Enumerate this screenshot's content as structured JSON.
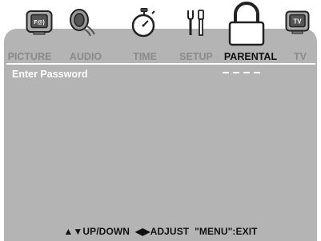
{
  "tabs": [
    {
      "label": "PICTURE",
      "icon": "picture-icon",
      "active": false
    },
    {
      "label": "AUDIO",
      "icon": "speaker-icon",
      "active": false
    },
    {
      "label": "TIME",
      "icon": "stopwatch-icon",
      "active": false
    },
    {
      "label": "SETUP",
      "icon": "tools-icon",
      "active": false
    },
    {
      "label": "PARENTAL",
      "icon": "lock-icon",
      "active": true
    },
    {
      "label": "TV",
      "icon": "tv-icon",
      "active": false
    }
  ],
  "parental": {
    "prompt": "Enter Password",
    "password_digits": 4,
    "password_filled": 0
  },
  "hints": {
    "updown": "UP/DOWN",
    "adjust": "ADJUST",
    "exit": "\"MENU\":EXIT"
  },
  "icon_text": {
    "picture": "F@)",
    "tv": "TV"
  },
  "colors": {
    "panel": "#b4b4b4",
    "active_tab": "#111111",
    "inactive_tab": "#8a8a8a",
    "prompt": "#ffffff"
  }
}
